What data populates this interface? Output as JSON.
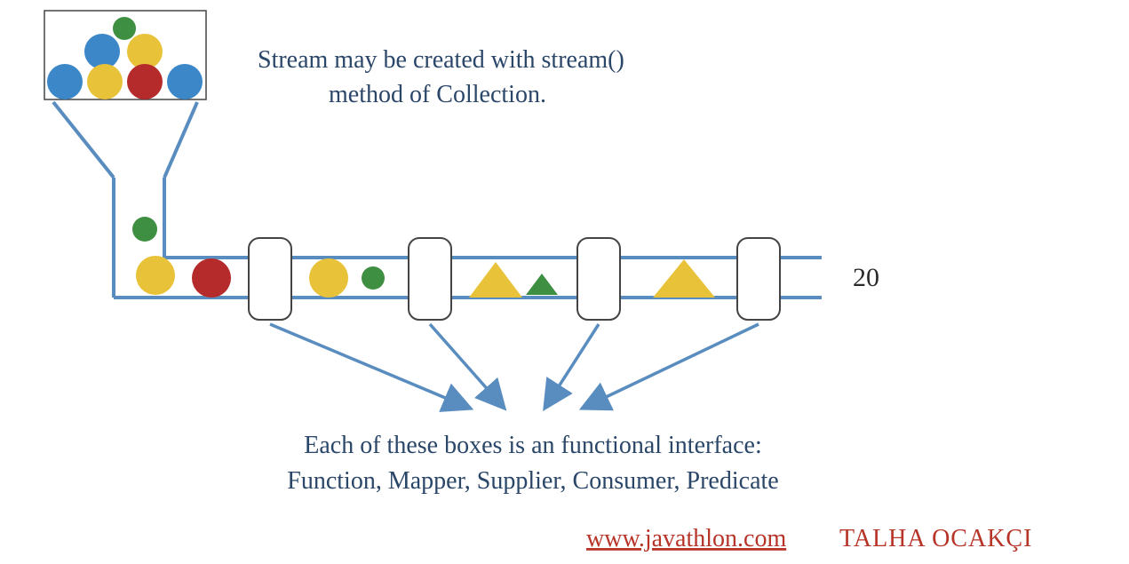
{
  "headline": {
    "line1": "Stream may be created with stream()",
    "line2": "method of Collection."
  },
  "caption": {
    "line1": "Each of these boxes is an functional interface:",
    "line2": "Function, Mapper, Supplier, Consumer, Predicate"
  },
  "result_value": "20",
  "footer": {
    "link_text": "www.javathlon.com",
    "author": "TALHA OCAKÇI"
  },
  "colors": {
    "blue_line": "#5a8dbf",
    "text_dark": "#2a4668",
    "red_link": "#b73429",
    "shape_green": "#3f8f42",
    "shape_yellow": "#e8c33a",
    "shape_blue": "#3b87c8",
    "shape_red": "#b52a2a",
    "box_stroke": "#444"
  }
}
